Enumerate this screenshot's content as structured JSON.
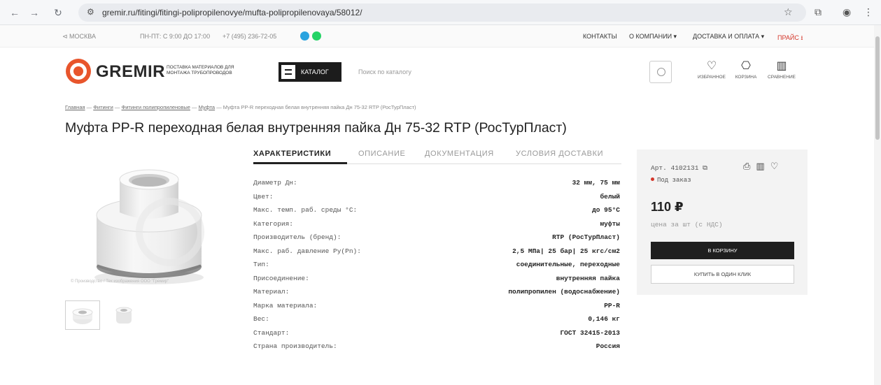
{
  "browser": {
    "url": "gremir.ru/fitingi/fitingi-polipropilenovye/mufta-polipropilenovaya/58012/"
  },
  "topbar": {
    "city": "МОСКВА",
    "hours": "ПН-ПТ: С 9:00 ДО 17:00",
    "phone": "+7 (495) 236-72-05",
    "menu": [
      "КОНТАКТЫ",
      "О КОМПАНИИ ▾",
      "ДОСТАВКА И ОПЛАТА ▾",
      "ПРАЙС ⭳"
    ],
    "colors": {
      "telegram": "#2aa3df",
      "whatsapp": "#25d366",
      "price_link": "#d4362a"
    }
  },
  "header": {
    "logo_text": "GREMIR",
    "logo_sub": "ПОСТАВКА МАТЕРИАЛОВ ДЛЯ МОНТАЖА ТРУБОПРОВОДОВ",
    "catalog_label": "КАТАЛОГ",
    "search_placeholder": "Поиск по каталогу",
    "icons": [
      {
        "label": "ИЗБРАННОЕ",
        "icon": "heart-icon",
        "glyph": "♡"
      },
      {
        "label": "КОРЗИНА",
        "icon": "cart-icon",
        "glyph": "🛍"
      },
      {
        "label": "СРАВНЕНИЕ",
        "icon": "compare-icon",
        "glyph": "📊"
      }
    ],
    "accent": "#e8552c"
  },
  "breadcrumb": {
    "items": [
      "Главная",
      "Фитинги",
      "Фитинги полипропиленовые",
      "Муфта"
    ],
    "separator": "—",
    "current": "Муфта PP-R переходная белая внутренняя пайка Дн 75-32 RTP (РосТурПласт)"
  },
  "page_title": "Муфта PP-R переходная белая внутренняя пайка Дн 75-32 RTP (РосТурПласт)",
  "gallery": {
    "watermark": "© Производство / Тех изображения ООО \"Гремир\""
  },
  "tabs": [
    "ХАРАКТЕРИСТИКИ",
    "ОПИСАНИЕ",
    "ДОКУМЕНТАЦИЯ",
    "УСЛОВИЯ ДОСТАВКИ"
  ],
  "specs": [
    {
      "k": "Диаметр Дн:",
      "v": "32 мм, 75 мм"
    },
    {
      "k": "Цвет:",
      "v": "белый"
    },
    {
      "k": "Макс. темп. раб. среды °C:",
      "v": "до 95°C"
    },
    {
      "k": "Категория:",
      "v": "муфты"
    },
    {
      "k": "Производитель (бренд):",
      "v": "RTP (РосТурПласт)"
    },
    {
      "k": "Макс. раб. давление Ру(Рn):",
      "v": "2,5 МПа| 25 бар| 25 кгс/см2"
    },
    {
      "k": "Тип:",
      "v": "соединительные, переходные"
    },
    {
      "k": "Присоединение:",
      "v": "внутренняя пайка"
    },
    {
      "k": "Материал:",
      "v": "полипропилен (водоснабжение)"
    },
    {
      "k": "Марка материала:",
      "v": "PP-R"
    },
    {
      "k": "Вес:",
      "v": "0,146 кг"
    },
    {
      "k": "Стандарт:",
      "v": "ГОСТ 32415-2013"
    },
    {
      "k": "Страна производитель:",
      "v": "Россия"
    }
  ],
  "buy": {
    "article": "Арт. 4102131",
    "status": "Под заказ",
    "price": "110 ₽",
    "unit": "цена за шт (с НДС)",
    "cart_button": "В КОРЗИНУ",
    "one_click_button": "КУПИТЬ В ОДИН КЛИК"
  }
}
